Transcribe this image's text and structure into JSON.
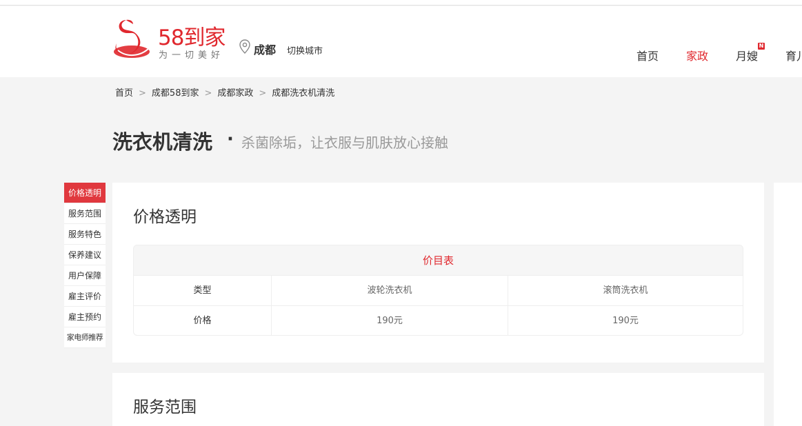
{
  "header": {
    "brand_name": "58到家",
    "brand_slogan": "为一切美好",
    "city": "成都",
    "switch_city": "切换城市",
    "nav": [
      {
        "label": "首页",
        "active": false
      },
      {
        "label": "家政",
        "active": true
      },
      {
        "label": "月嫂",
        "active": false,
        "badge": "N"
      },
      {
        "label": "育儿",
        "active": false
      }
    ],
    "brand_color": "#e0282e"
  },
  "breadcrumb": {
    "items": [
      "首页",
      "成都58到家",
      "成都家政",
      "成都洗衣机清洗"
    ],
    "separator": ">"
  },
  "page": {
    "title": "洗衣机清洗",
    "dot": "·",
    "subtitle": "杀菌除垢，让衣服与肌肤放心接触"
  },
  "side_nav": {
    "items": [
      "价格透明",
      "服务范围",
      "服务特色",
      "保养建议",
      "用户保障",
      "雇主评价",
      "雇主预约",
      "家电师推荐"
    ],
    "active_index": 0
  },
  "price_section": {
    "title": "价格透明",
    "table_title": "价目表",
    "rows": [
      {
        "label": "类型",
        "col1": "波轮洗衣机",
        "col2": "滚筒洗衣机"
      },
      {
        "label": "价格",
        "col1": "190元",
        "col2": "190元"
      }
    ]
  },
  "service_section": {
    "title": "服务范围"
  }
}
